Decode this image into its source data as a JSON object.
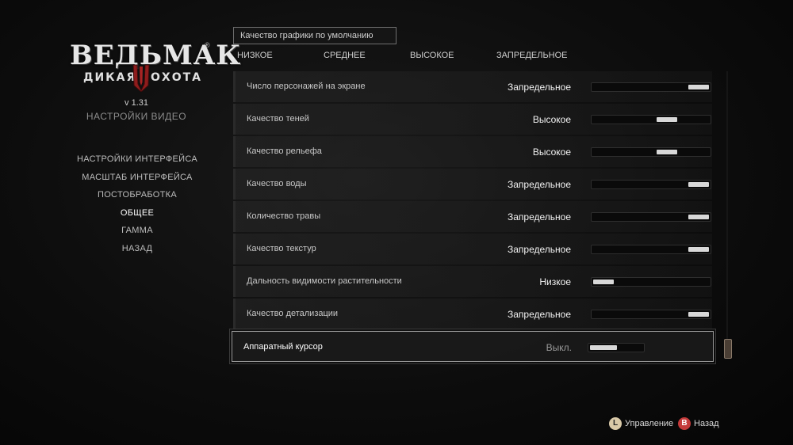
{
  "logo": {
    "title": "ВЕДЬМАК",
    "subtitle_left": "ДИКАЯ",
    "subtitle_right": "ОХОТА",
    "registered": "®"
  },
  "version": "v 1.31",
  "section_title": "НАСТРОЙКИ ВИДЕО",
  "left_menu": [
    {
      "label": "НАСТРОЙКИ ИНТЕРФЕЙСА"
    },
    {
      "label": "МАСШТАБ ИНТЕРФЕЙСА"
    },
    {
      "label": "ПОСТОБРАБОТКА"
    },
    {
      "label": "ОБЩЕЕ"
    },
    {
      "label": "ГАММА"
    },
    {
      "label": "НАЗАД"
    }
  ],
  "preset": {
    "label": "Качество графики по умолчанию",
    "options": [
      "НИЗКОЕ",
      "СРЕДНЕЕ",
      "ВЫСОКОЕ",
      "ЗАПРЕДЕЛЬНОЕ"
    ]
  },
  "settings": [
    {
      "label": "Число персонажей на экране",
      "value": "Запредельное",
      "level": 1.0
    },
    {
      "label": "Качество теней",
      "value": "Высокое",
      "level": 0.67
    },
    {
      "label": "Качество рельефа",
      "value": "Высокое",
      "level": 0.67
    },
    {
      "label": "Качество воды",
      "value": "Запредельное",
      "level": 1.0
    },
    {
      "label": "Количество травы",
      "value": "Запредельное",
      "level": 1.0
    },
    {
      "label": "Качество текстур",
      "value": "Запредельное",
      "level": 1.0
    },
    {
      "label": "Дальность видимости растительности",
      "value": "Низкое",
      "level": 0.0
    },
    {
      "label": "Качество детализации",
      "value": "Запредельное",
      "level": 1.0
    },
    {
      "label": "Аппаратный курсор",
      "value": "Выкл.",
      "level": 0.0
    }
  ],
  "hints": {
    "controls_button": "L",
    "controls_label": "Управление",
    "back_button": "B",
    "back_label": "Назад"
  },
  "colors": {
    "accent_red": "#c43a3a",
    "emblem_red": "#8e1c1c"
  }
}
